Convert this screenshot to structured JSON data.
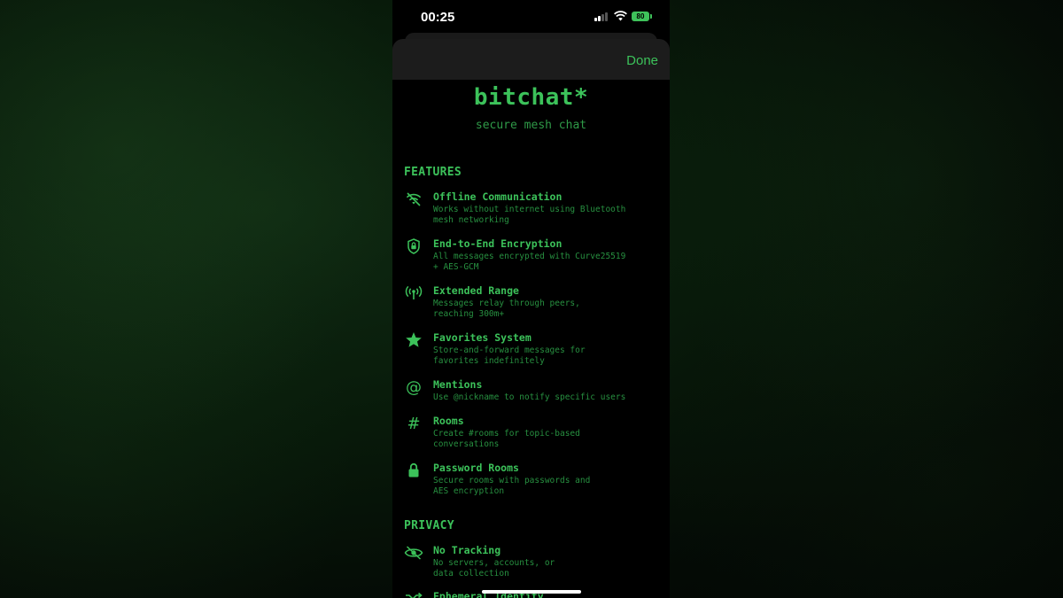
{
  "status_bar": {
    "time": "00:25",
    "battery": "80"
  },
  "sheet": {
    "done_label": "Done"
  },
  "app": {
    "title": "bitchat*",
    "subtitle": "secure mesh chat"
  },
  "sections": {
    "features_heading": "FEATURES",
    "privacy_heading": "PRIVACY"
  },
  "features": [
    {
      "icon": "wifi-slash-icon",
      "title": "Offline Communication",
      "desc": "Works without internet using Bluetooth\nmesh networking"
    },
    {
      "icon": "lock-shield-icon",
      "title": "End-to-End Encryption",
      "desc": "All messages encrypted with Curve25519\n+ AES-GCM"
    },
    {
      "icon": "antenna-icon",
      "title": "Extended Range",
      "desc": "Messages relay through peers,\nreaching 300m+"
    },
    {
      "icon": "star-icon",
      "title": "Favorites System",
      "desc": "Store-and-forward messages for\nfavorites indefinitely"
    },
    {
      "icon": "at-icon",
      "title": "Mentions",
      "desc": "Use @nickname to notify specific users"
    },
    {
      "icon": "hash-icon",
      "title": "Rooms",
      "desc": "Create #rooms for topic-based\nconversations"
    },
    {
      "icon": "lock-icon",
      "title": "Password Rooms",
      "desc": "Secure rooms with passwords and\nAES encryption"
    }
  ],
  "privacy": [
    {
      "icon": "eye-slash-icon",
      "title": "No Tracking",
      "desc": "No servers, accounts, or\ndata collection"
    },
    {
      "icon": "shuffle-icon",
      "title": "Ephemeral Identity",
      "desc": ""
    }
  ],
  "colors": {
    "accent": "#3cc25a",
    "muted": "#279040",
    "background": "#000000"
  }
}
